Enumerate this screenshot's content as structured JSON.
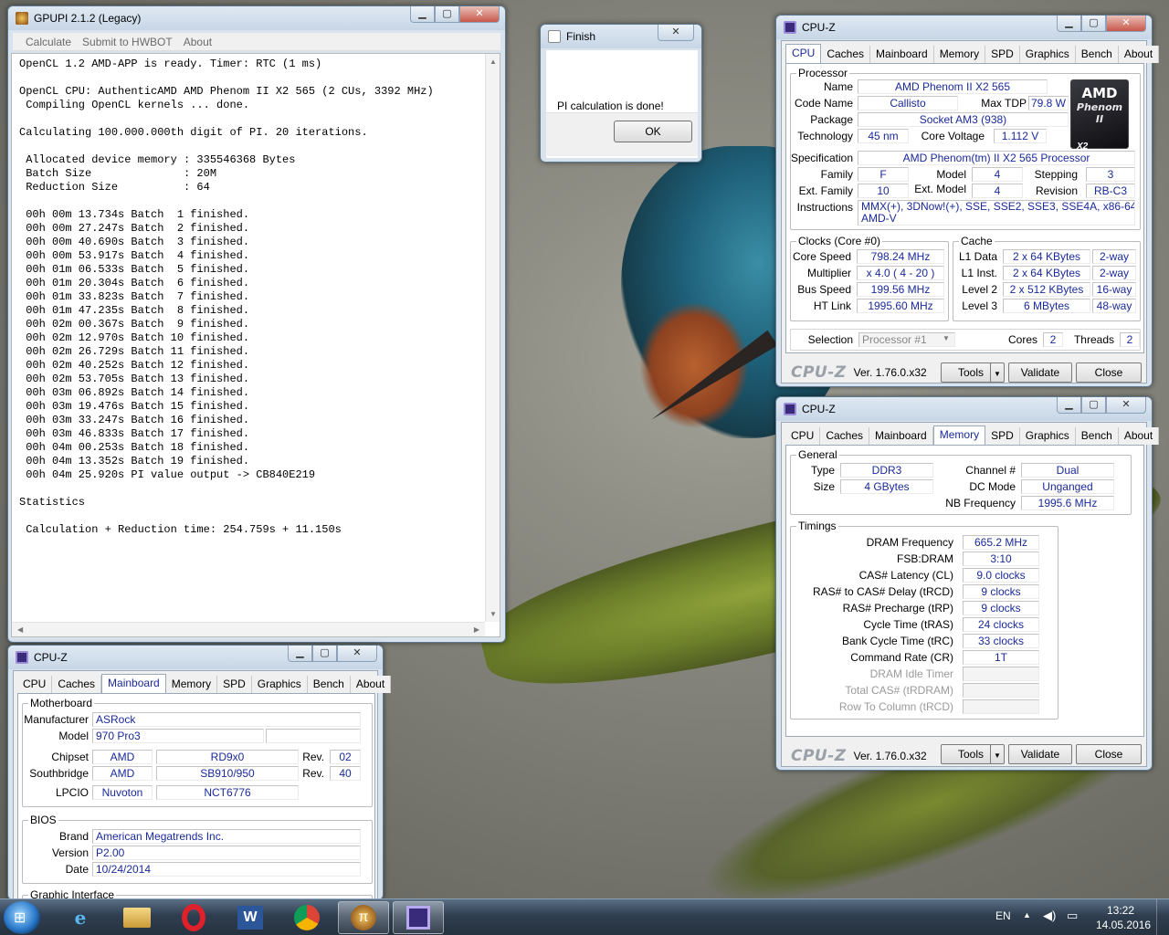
{
  "gpupi": {
    "title": "GPUPI 2.1.2 (Legacy)",
    "menu": [
      "Calculate",
      "Submit to HWBOT",
      "About"
    ],
    "output": "OpenCL 1.2 AMD-APP is ready. Timer: RTC (1 ms)\n\nOpenCL CPU: AuthenticAMD AMD Phenom II X2 565 (2 CUs, 3392 MHz)\n Compiling OpenCL kernels ... done.\n\nCalculating 100.000.000th digit of PI. 20 iterations.\n\n Allocated device memory : 335546368 Bytes\n Batch Size              : 20M\n Reduction Size          : 64\n\n 00h 00m 13.734s Batch  1 finished.\n 00h 00m 27.247s Batch  2 finished.\n 00h 00m 40.690s Batch  3 finished.\n 00h 00m 53.917s Batch  4 finished.\n 00h 01m 06.533s Batch  5 finished.\n 00h 01m 20.304s Batch  6 finished.\n 00h 01m 33.823s Batch  7 finished.\n 00h 01m 47.235s Batch  8 finished.\n 00h 02m 00.367s Batch  9 finished.\n 00h 02m 12.970s Batch 10 finished.\n 00h 02m 26.729s Batch 11 finished.\n 00h 02m 40.252s Batch 12 finished.\n 00h 02m 53.705s Batch 13 finished.\n 00h 03m 06.892s Batch 14 finished.\n 00h 03m 19.476s Batch 15 finished.\n 00h 03m 33.247s Batch 16 finished.\n 00h 03m 46.833s Batch 17 finished.\n 00h 04m 00.253s Batch 18 finished.\n 00h 04m 13.352s Batch 19 finished.\n 00h 04m 25.920s PI value output -> CB840E219\n\nStatistics\n\n Calculation + Reduction time: 254.759s + 11.150s"
  },
  "finish": {
    "title": "Finish",
    "message": "PI calculation is done!",
    "ok": "OK"
  },
  "cpuz_common": {
    "title": "CPU-Z",
    "tabs": [
      "CPU",
      "Caches",
      "Mainboard",
      "Memory",
      "SPD",
      "Graphics",
      "Bench",
      "About"
    ],
    "brand": "CPU-Z",
    "version": "Ver. 1.76.0.x32",
    "tools": "Tools",
    "tools_arrow": "▼",
    "validate": "Validate",
    "close": "Close"
  },
  "cpu": {
    "processor_group": "Processor",
    "name_label": "Name",
    "name": "AMD Phenom II X2 565",
    "codename_label": "Code Name",
    "codename": "Callisto",
    "maxtdp_label": "Max TDP",
    "maxtdp": "79.8 W",
    "package_label": "Package",
    "package": "Socket AM3 (938)",
    "technology_label": "Technology",
    "technology": "45 nm",
    "corevoltage_label": "Core Voltage",
    "corevoltage": "1.112 V",
    "spec_label": "Specification",
    "spec": "AMD Phenom(tm) II X2 565 Processor",
    "family_label": "Family",
    "family": "F",
    "model_label": "Model",
    "model": "4",
    "stepping_label": "Stepping",
    "stepping": "3",
    "extfamily_label": "Ext. Family",
    "extfamily": "10",
    "extmodel_label": "Ext. Model",
    "extmodel": "4",
    "revision_label": "Revision",
    "revision": "RB-C3",
    "instructions_label": "Instructions",
    "instructions": "MMX(+), 3DNow!(+), SSE, SSE2, SSE3, SSE4A, x86-64,\nAMD-V",
    "logo_line1": "AMD",
    "logo_line2": "Phenom II",
    "logo_line3": "X2",
    "clocks_group": "Clocks (Core #0)",
    "corespeed_label": "Core Speed",
    "corespeed": "798.24 MHz",
    "multiplier_label": "Multiplier",
    "multiplier": "x 4.0 ( 4 - 20 )",
    "busspeed_label": "Bus Speed",
    "busspeed": "199.56 MHz",
    "htlink_label": "HT Link",
    "htlink": "1995.60 MHz",
    "cache_group": "Cache",
    "l1d_label": "L1 Data",
    "l1d": "2 x 64 KBytes",
    "l1d_way": "2-way",
    "l1i_label": "L1 Inst.",
    "l1i": "2 x 64 KBytes",
    "l1i_way": "2-way",
    "l2_label": "Level 2",
    "l2": "2 x 512 KBytes",
    "l2_way": "16-way",
    "l3_label": "Level 3",
    "l3": "6 MBytes",
    "l3_way": "48-way",
    "selection_label": "Selection",
    "selection": "Processor #1",
    "cores_label": "Cores",
    "cores": "2",
    "threads_label": "Threads",
    "threads": "2"
  },
  "memory": {
    "general_group": "General",
    "type_label": "Type",
    "type": "DDR3",
    "size_label": "Size",
    "size": "4 GBytes",
    "channel_label": "Channel #",
    "channel": "Dual",
    "dcmode_label": "DC Mode",
    "dcmode": "Unganged",
    "nbfreq_label": "NB Frequency",
    "nbfreq": "1995.6 MHz",
    "timings_group": "Timings",
    "dramfreq_label": "DRAM Frequency",
    "dramfreq": "665.2 MHz",
    "fsbdram_label": "FSB:DRAM",
    "fsbdram": "3:10",
    "cl_label": "CAS# Latency (CL)",
    "cl": "9.0 clocks",
    "trcd_label": "RAS# to CAS# Delay (tRCD)",
    "trcd": "9 clocks",
    "trp_label": "RAS# Precharge (tRP)",
    "trp": "9 clocks",
    "tras_label": "Cycle Time (tRAS)",
    "tras": "24 clocks",
    "trc_label": "Bank Cycle Time (tRC)",
    "trc": "33 clocks",
    "cr_label": "Command Rate (CR)",
    "cr": "1T",
    "idle_label": "DRAM Idle Timer",
    "trdram_label": "Total CAS# (tRDRAM)",
    "rtc_label": "Row To Column (tRCD)"
  },
  "mainboard": {
    "mb_group": "Motherboard",
    "manufacturer_label": "Manufacturer",
    "manufacturer": "ASRock",
    "model_label": "Model",
    "model": "970 Pro3",
    "chipset_label": "Chipset",
    "chipset_vendor": "AMD",
    "chipset": "RD9x0",
    "chipset_rev": "02",
    "southbridge_label": "Southbridge",
    "sb_vendor": "AMD",
    "sb": "SB910/950",
    "sb_rev": "40",
    "rev_label": "Rev.",
    "lpcio_label": "LPCIO",
    "lpcio_vendor": "Nuvoton",
    "lpcio": "NCT6776",
    "bios_group": "BIOS",
    "brand_label": "Brand",
    "brand": "American Megatrends Inc.",
    "version_label": "Version",
    "version": "P2.00",
    "date_label": "Date",
    "date": "10/24/2014",
    "graphic_group": "Graphic Interface"
  },
  "taskbar": {
    "lang": "EN",
    "time": "13:22",
    "date": "14.05.2016"
  }
}
